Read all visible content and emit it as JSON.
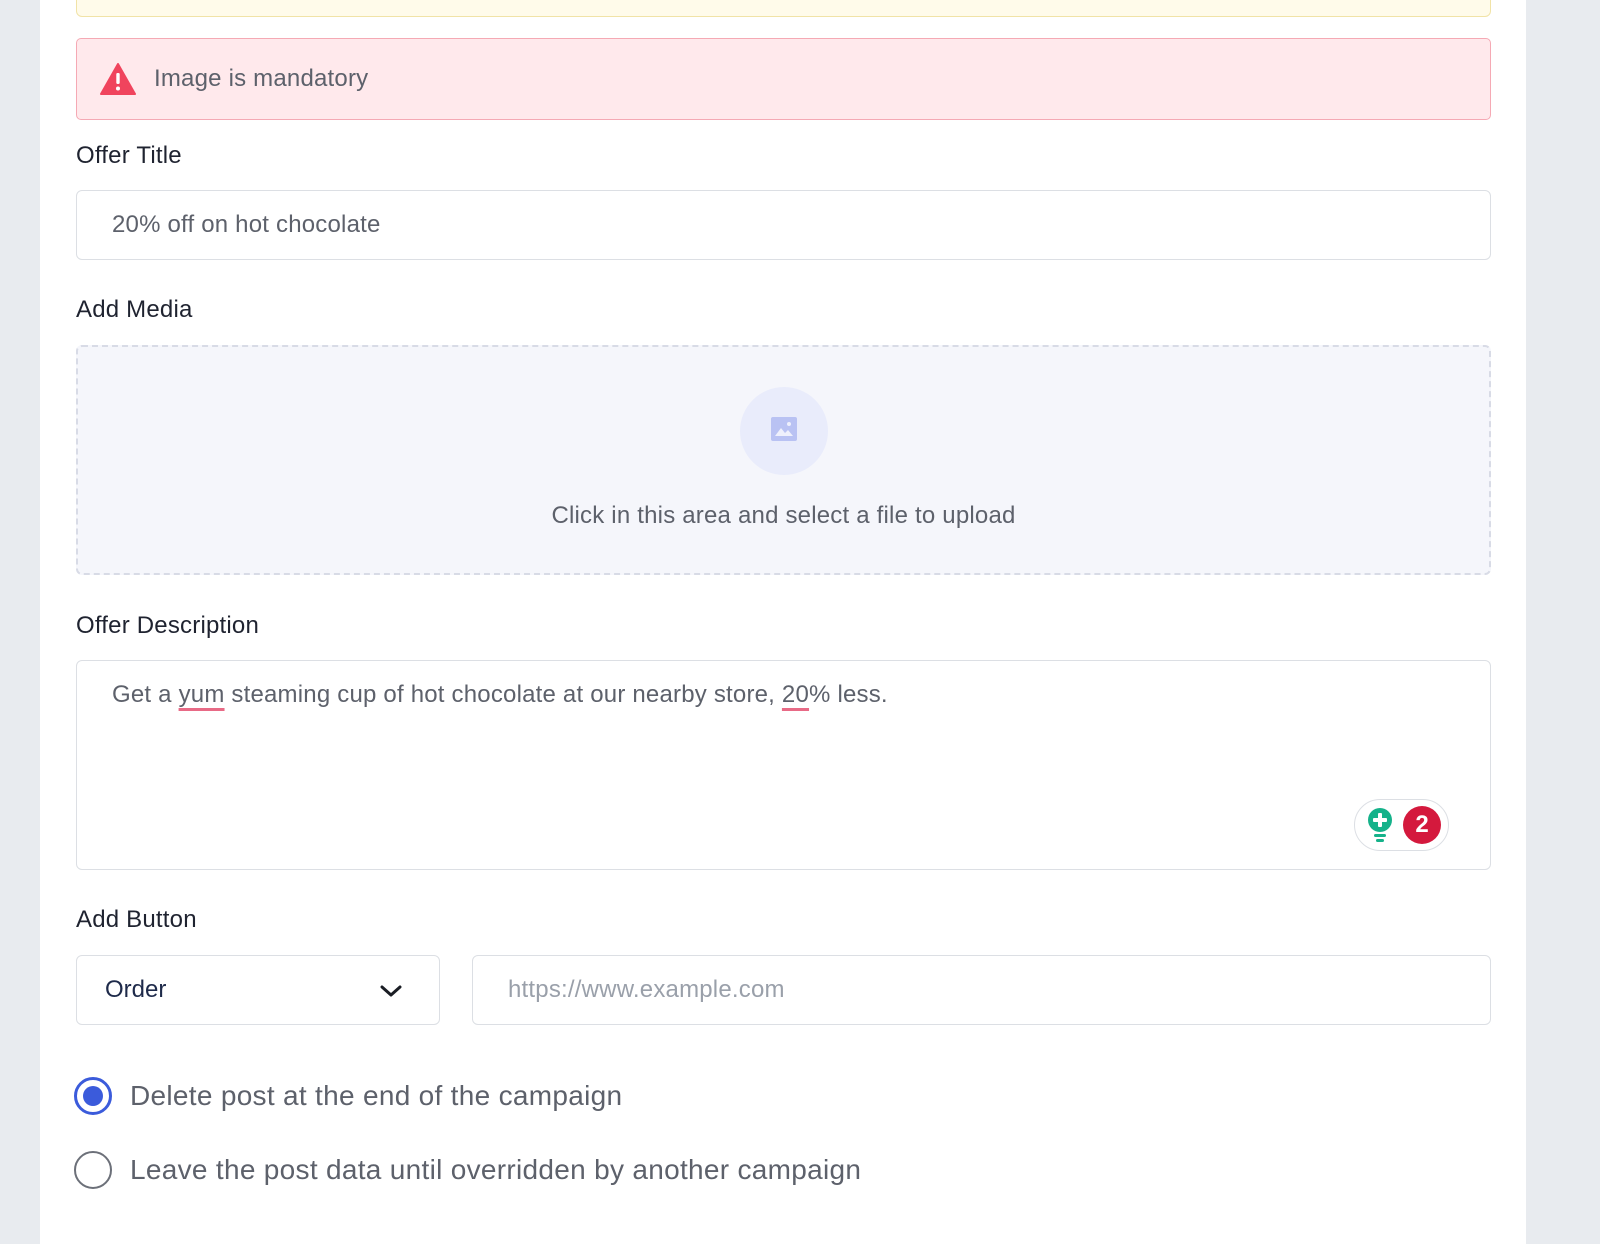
{
  "alert": {
    "message": "Image is mandatory",
    "icon": "warning-triangle-icon",
    "color": "#f0445d"
  },
  "form": {
    "offer_title": {
      "label": "Offer Title",
      "value": "20% off on hot chocolate"
    },
    "media": {
      "label": "Add Media",
      "upload_text": "Click in this area and select a file to upload",
      "icon": "image-icon"
    },
    "description": {
      "label": "Offer Description",
      "value_parts": [
        "Get a ",
        "yum",
        " steaming cup of hot chocolate at our nearby store, ",
        "20",
        "% less."
      ],
      "grammarly_count": "2"
    },
    "button": {
      "label": "Add Button",
      "selected": "Order",
      "url_placeholder": "https://www.example.com"
    },
    "post_options": [
      {
        "label": "Delete post at the end of the campaign",
        "checked": true
      },
      {
        "label": "Leave the post data until overridden by another campaign",
        "checked": false
      }
    ]
  },
  "colors": {
    "accent": "#3b5bdb",
    "error_bg": "#ffe9ec",
    "grammarly_badge": "#d4193d"
  }
}
